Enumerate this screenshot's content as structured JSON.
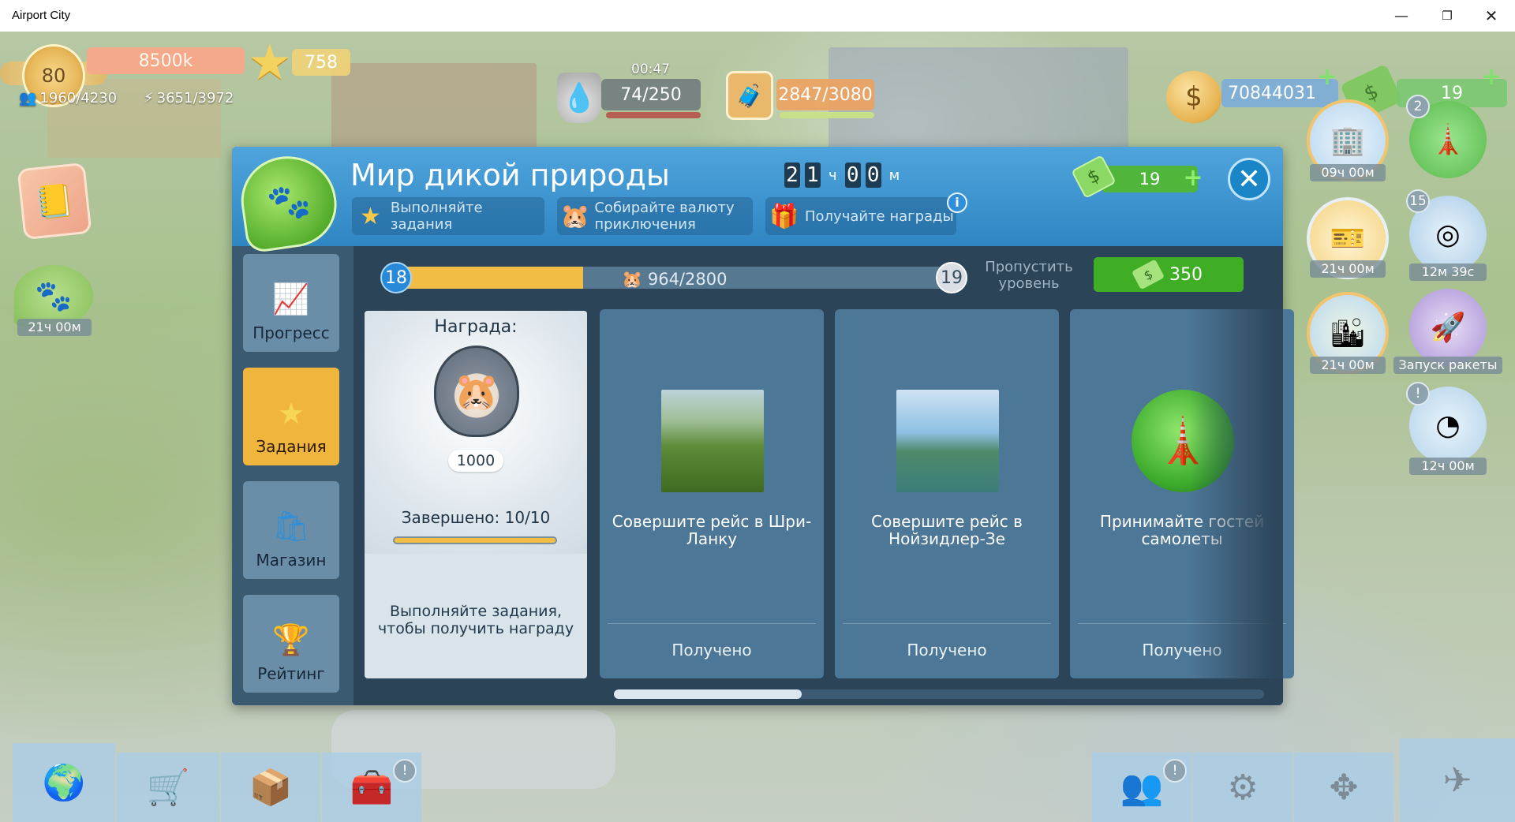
{
  "window": {
    "title": "Airport City",
    "min": "—",
    "max": "❐",
    "close": "✕"
  },
  "hud": {
    "level": "80",
    "xp": "8500k",
    "stars": "758",
    "population": "1960/4230",
    "energy": "3651/3972",
    "fuel_timer": "00:47",
    "fuel": "74/250",
    "cargo": "2847/3080",
    "coins": "70844031",
    "cash": "19"
  },
  "left_side": {
    "event_timer": "21ч 00м"
  },
  "right_side": {
    "items": [
      {
        "timer": "09ч 00м"
      },
      {
        "timer": "21ч 00м"
      },
      {
        "timer": "21ч 00м"
      },
      {
        "timer": "12м 39с",
        "badge": "15"
      },
      {
        "timer": "Запуск ракеты"
      },
      {
        "timer": "12ч 00м",
        "badge": "!"
      },
      {
        "badge": "2"
      }
    ]
  },
  "dialog": {
    "title": "Мир дикой природы",
    "timer": {
      "h1": "2",
      "h2": "1",
      "h_unit": "ч",
      "m1": "0",
      "m2": "0",
      "m_unit": "м"
    },
    "header_tabs": [
      {
        "label": "Выполняйте задания"
      },
      {
        "label": "Собирайте валюту приключения"
      },
      {
        "label": "Получайте награды"
      }
    ],
    "info": "i",
    "cash": "19",
    "close": "✕",
    "side_tabs": [
      {
        "label": "Прогресс"
      },
      {
        "label": "Задания"
      },
      {
        "label": "Магазин"
      },
      {
        "label": "Рейтинг"
      }
    ],
    "progress": {
      "current_level": "18",
      "next_level": "19",
      "text": "964/2800",
      "fraction": 0.34,
      "skip_label": "Пропустить уровень",
      "skip_cost": "350"
    },
    "reward": {
      "title": "Награда:",
      "value": "1000",
      "completed": "Завершено: 10/10",
      "description": "Выполняйте задания, чтобы получить награду"
    },
    "tasks": [
      {
        "text": "Совершите рейс в Шри-Ланку",
        "status": "Получено"
      },
      {
        "text": "Совершите рейс в Нойзидлер-Зе",
        "status": "Получено"
      },
      {
        "text": "Принимайте гостей самолеты",
        "status": "Получено"
      }
    ]
  }
}
